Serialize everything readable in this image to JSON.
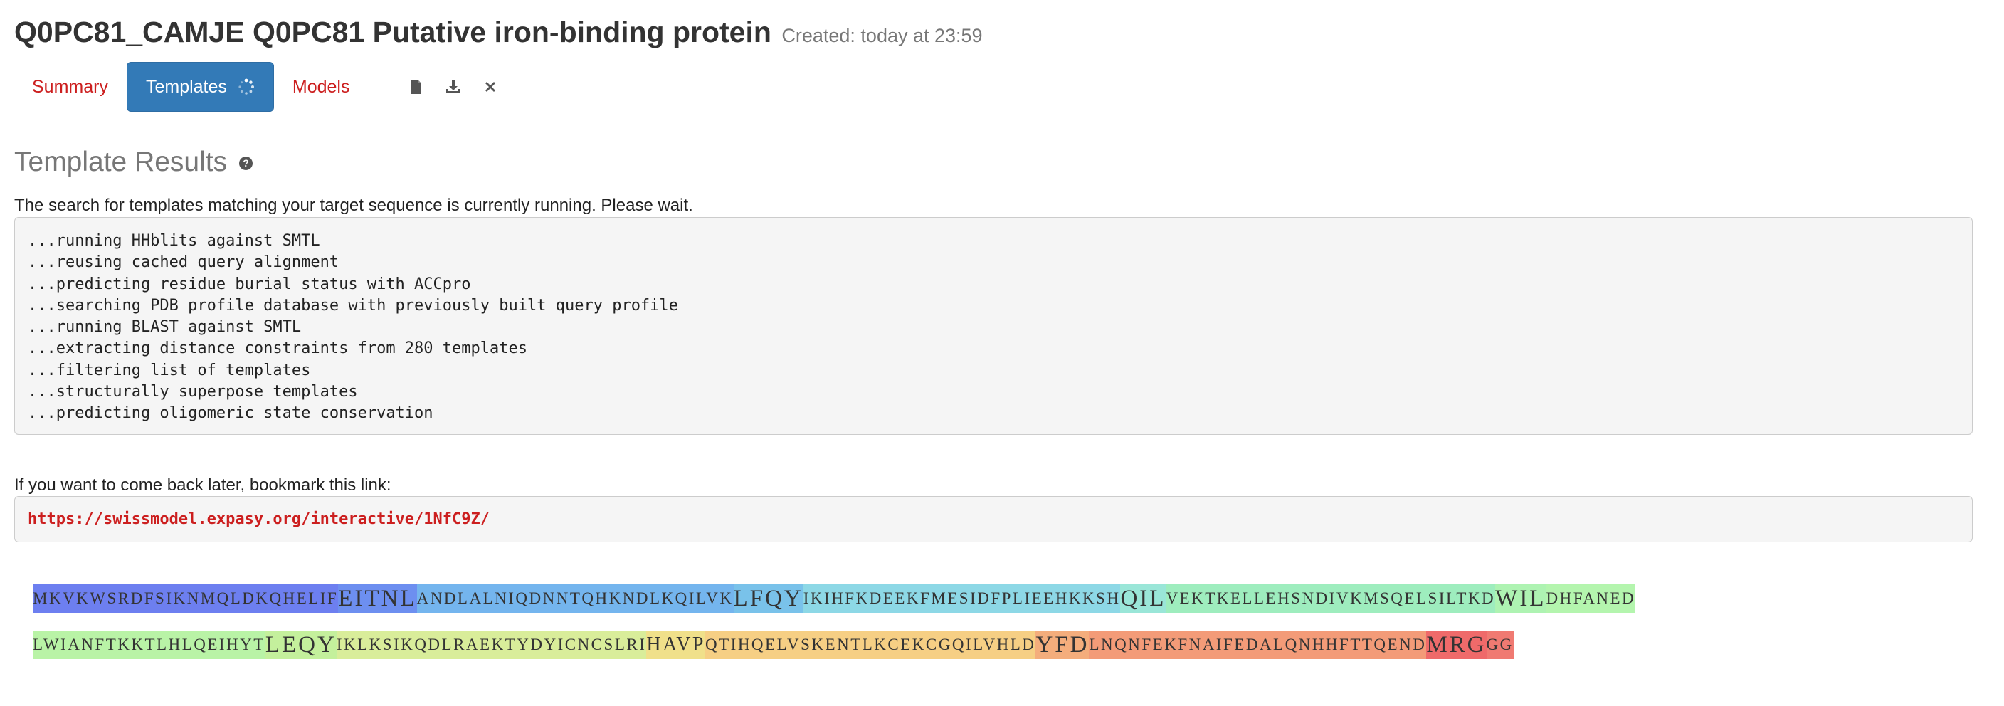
{
  "header": {
    "title": "Q0PC81_CAMJE Q0PC81 Putative iron-binding protein",
    "created": "Created: today at 23:59"
  },
  "tabs": [
    {
      "label": "Summary",
      "active": false
    },
    {
      "label": "Templates",
      "active": true
    },
    {
      "label": "Models",
      "active": false
    }
  ],
  "toolbar_icons": [
    "file-icon",
    "download-icon",
    "close-icon"
  ],
  "section": {
    "title": "Template Results",
    "help_glyph": "?",
    "status_text": "The search for templates matching your target sequence is currently running. Please wait."
  },
  "log": [
    "...running HHblits against SMTL",
    "...reusing cached query alignment",
    "...predicting residue burial status with ACCpro",
    "...searching PDB profile database with previously built query profile",
    "...running BLAST against SMTL",
    "...extracting distance constraints from 280 templates",
    "...filtering list of templates",
    "...structurally superpose templates",
    "...predicting oligomeric state conservation"
  ],
  "bookmark": {
    "text": "If you want to come back later, bookmark this link:",
    "url": "https://swissmodel.expasy.org/interactive/1NfC9Z/"
  },
  "sequence": {
    "row1": [
      {
        "text": "MKVKWSRDFSIKNMQLDKQHELIF",
        "size": "normal",
        "color": "#6d7ff0"
      },
      {
        "text": "EITNL",
        "size": "big",
        "color": "#6d8ff0"
      },
      {
        "text": "ANDLALNIQDNNTQHKNDLKQILVK",
        "size": "normal",
        "color": "#74b5ee"
      },
      {
        "text": "LFQY",
        "size": "big",
        "color": "#79c2ea"
      },
      {
        "text": "IKIHFKDEEKFMESIDFPLIEEHKKSH",
        "size": "normal",
        "color": "#8dd8e6"
      },
      {
        "text": "QIL",
        "size": "big",
        "color": "#9ae6d8"
      },
      {
        "text": "VEKTKELLEHSNDIVKMSQELSILTKD",
        "size": "normal",
        "color": "#9eedbe"
      },
      {
        "text": "WIL",
        "size": "big",
        "color": "#aef3b2"
      },
      {
        "text": "DHFANED",
        "size": "normal",
        "color": "#b4f5ae"
      }
    ],
    "row2": [
      {
        "text": "LWIANFTKKTLHLQEIHYT",
        "size": "normal",
        "color": "#b9f3a6"
      },
      {
        "text": "LEQY",
        "size": "big",
        "color": "#c4f09c"
      },
      {
        "text": "IKLKSIKQDLRAEKTYDYICNCSLRI",
        "size": "normal",
        "color": "#d9ed9a"
      },
      {
        "text": "HAVP",
        "size": "mid",
        "color": "#f0e08a"
      },
      {
        "text": "QTIHQELVSKENTLKCEKCGQILVHLD",
        "size": "normal",
        "color": "#f6cf84"
      },
      {
        "text": "YFD",
        "size": "big",
        "color": "#f4ad7c"
      },
      {
        "text": "LNQNFEKFNAIFEDALQNHHFTTQEND",
        "size": "normal",
        "color": "#f39b78"
      },
      {
        "text": "MRG",
        "size": "big",
        "color": "#ef6a6a"
      },
      {
        "text": "GG",
        "size": "normal",
        "color": "#f07a72"
      }
    ]
  }
}
